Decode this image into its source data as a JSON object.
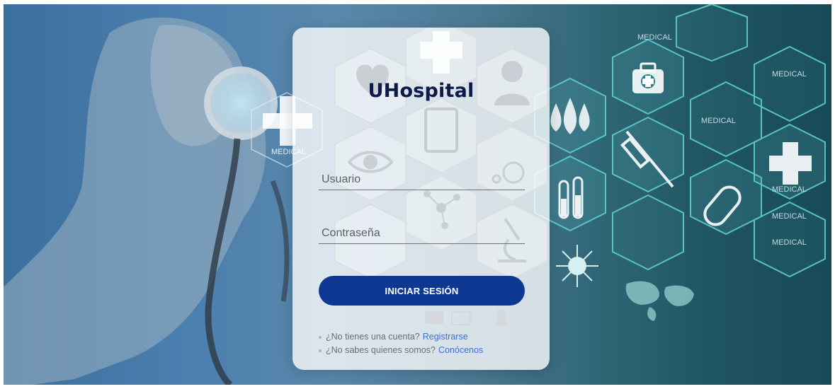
{
  "app": {
    "title": "UHospital"
  },
  "background": {
    "labels": [
      "MEDICAL",
      "MEDICAL",
      "MEDICAL",
      "MEDICAL",
      "MEDICAL",
      "MEDICAL",
      "MEDICAL"
    ]
  },
  "login_form": {
    "username": {
      "placeholder": "Usuario",
      "value": ""
    },
    "password": {
      "placeholder": "Contraseña",
      "value": ""
    },
    "submit_label": "INICIAR SESIÓN"
  },
  "links": {
    "register_prompt": "¿No tienes una cuenta?",
    "register_link": "Registrarse",
    "about_prompt": "¿No sabes quienes somos?",
    "about_link": "Conócenos"
  },
  "colors": {
    "brand_navy": "#0d1a4a",
    "button_blue": "#0e3891",
    "link_blue": "#3c6fd8",
    "teal_accent": "#41c7c3"
  },
  "icons": [
    "medical-cross-icon",
    "heart-icon",
    "doctor-icon",
    "clipboard-icon",
    "eye-icon",
    "wheelchair-icon",
    "molecule-icon",
    "microscope-icon",
    "first-aid-kit-icon",
    "blood-drops-icon",
    "syringe-icon",
    "test-tubes-icon",
    "pill-icon",
    "virus-icon",
    "world-map-icon",
    "stethoscope-icon",
    "mail-icon",
    "monitor-icon",
    "phone-icon"
  ]
}
